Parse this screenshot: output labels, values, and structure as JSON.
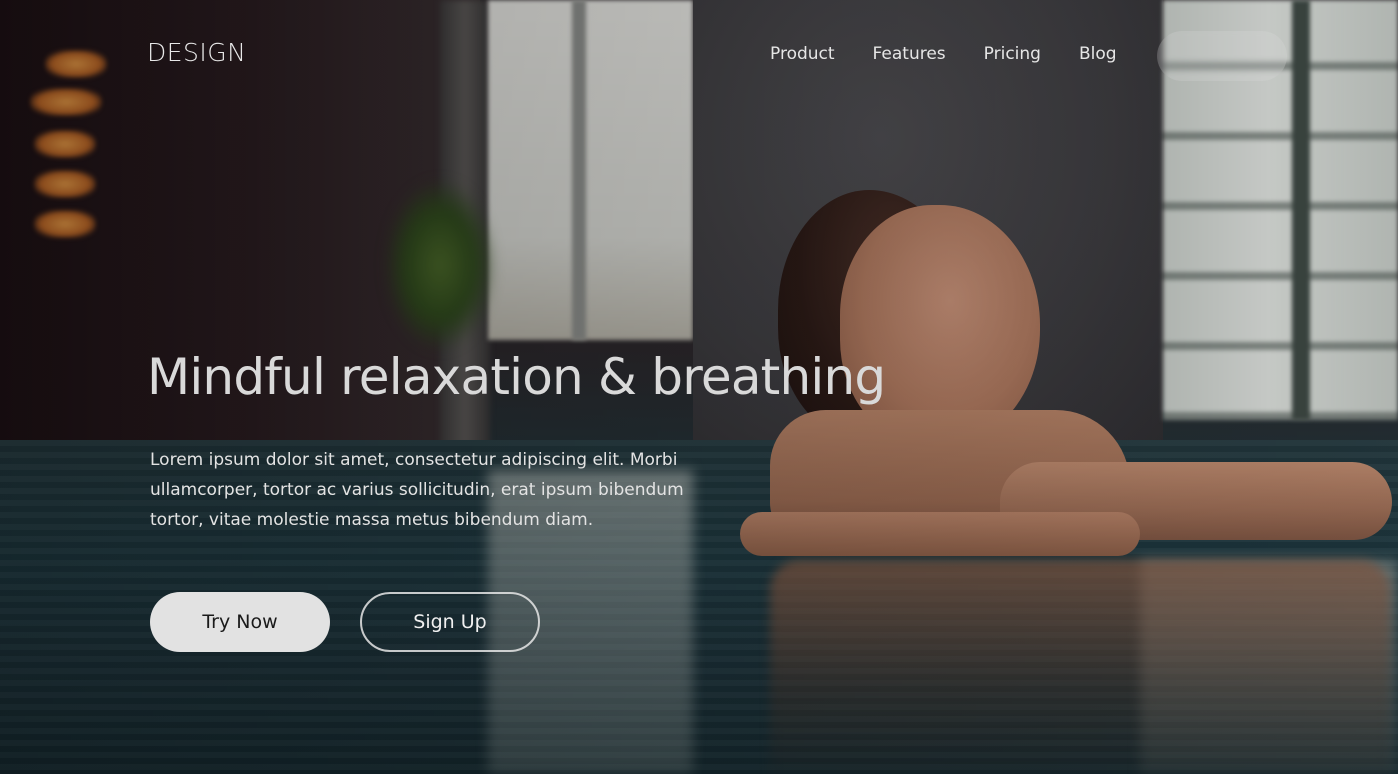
{
  "header": {
    "logo": "DESIGN",
    "nav": [
      {
        "label": "Product"
      },
      {
        "label": "Features"
      },
      {
        "label": "Pricing"
      },
      {
        "label": "Blog"
      }
    ],
    "cta_label": ""
  },
  "hero": {
    "title": "Mindful relaxation & breathing",
    "description": "Lorem ipsum dolor sit amet, consectetur adipiscing elit. Morbi ullamcorper, tortor ac varius sollicitudin, erat ipsum bibendum tortor, vitae molestie massa metus bibendum diam.",
    "primary_button": "Try Now",
    "secondary_button": "Sign Up"
  },
  "colors": {
    "text_light": "#e6e6e6",
    "primary_button_bg": "#e2e2e2",
    "primary_button_text": "#1a1a1a",
    "secondary_button_border": "#e6e6e6"
  }
}
